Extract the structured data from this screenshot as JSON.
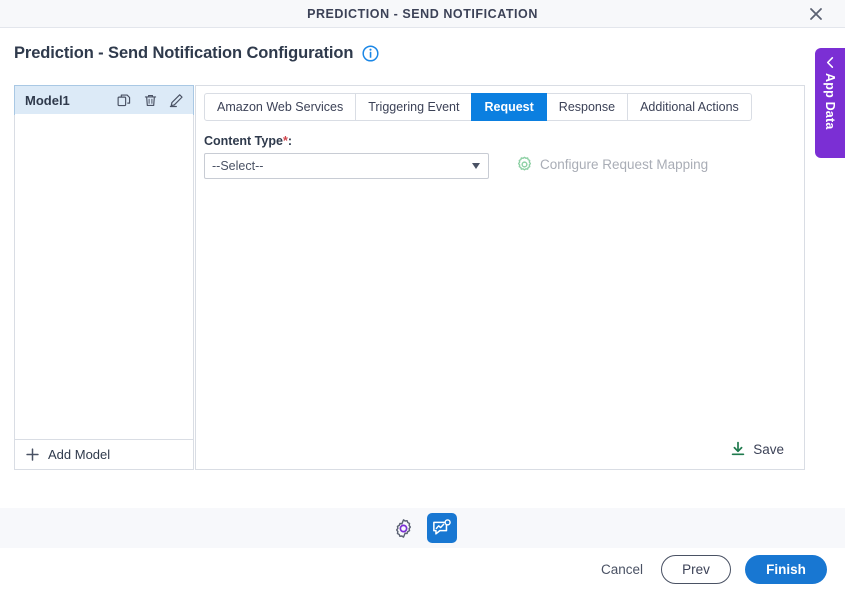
{
  "window": {
    "title": "PREDICTION - SEND NOTIFICATION",
    "close_icon": "close-icon"
  },
  "page": {
    "title": "Prediction - Send Notification Configuration",
    "info_icon": "info-icon"
  },
  "model_panel": {
    "selected_model": "Model1",
    "row_icons": [
      {
        "name": "copy-icon",
        "label": "Copy"
      },
      {
        "name": "delete-icon",
        "label": "Delete"
      },
      {
        "name": "edit-icon",
        "label": "Edit"
      }
    ],
    "add_model_label": "Add Model",
    "add_icon": "plus-icon"
  },
  "tabs": [
    {
      "label": "Amazon Web Services",
      "active": false
    },
    {
      "label": "Triggering Event",
      "active": false
    },
    {
      "label": "Request",
      "active": true
    },
    {
      "label": "Response",
      "active": false
    },
    {
      "label": "Additional Actions",
      "active": false
    }
  ],
  "request_form": {
    "content_type_label": "Content Type",
    "required_marker": "*",
    "label_colon": ":",
    "content_type_value": "--Select--",
    "content_type_placeholder": "--Select--",
    "configure_mapping_label": "Configure Request Mapping",
    "configure_mapping_icon": "gear-icon",
    "configure_mapping_disabled": true
  },
  "save": {
    "label": "Save",
    "icon": "download-icon"
  },
  "app_data_panel": {
    "label": "App Data",
    "chevron_icon": "chevron-left-icon"
  },
  "toolbar": {
    "buttons": [
      {
        "name": "settings-icon",
        "label": "Settings",
        "active": false
      },
      {
        "name": "chat-analytics-icon",
        "label": "Feedback",
        "active": true
      }
    ]
  },
  "footer": {
    "cancel_label": "Cancel",
    "prev_label": "Prev",
    "finish_label": "Finish"
  },
  "colors": {
    "accent_blue": "#1877d2",
    "tab_active_blue": "#0b7fe0",
    "app_data_purple": "#7b2fd4",
    "save_green": "#1f7a4d",
    "required_red": "#d0454c",
    "titlebar_bg": "#f7f8fa",
    "toolbar_band_bg": "#f7f8fb",
    "selected_row_bg": "#dceaf7"
  }
}
